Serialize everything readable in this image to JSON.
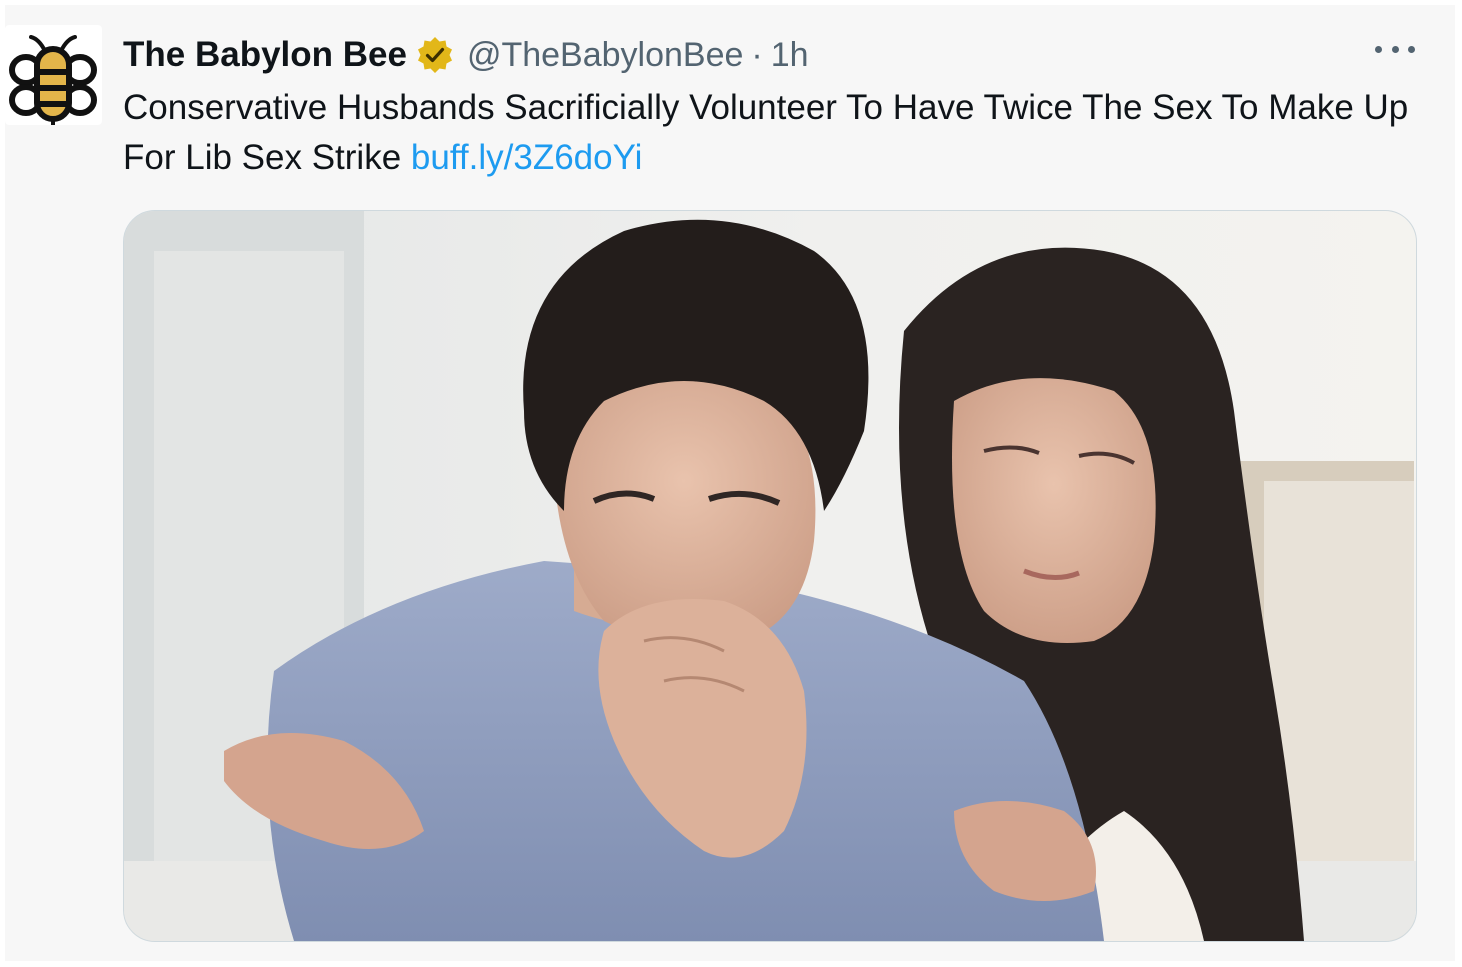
{
  "tweet": {
    "author_name": "The Babylon Bee",
    "handle": "@TheBabylonBee",
    "separator": "·",
    "time": "1h",
    "text": "Conservative Husbands Sacrificially Volunteer To Have Twice The Sex To Make Up For Lib Sex Strike",
    "link": "buff.ly/3Z6doYi",
    "verified_icon": "gold-verified-badge-icon",
    "more_icon": "more-options-icon",
    "media_alt": "man-and-woman-photo"
  },
  "colors": {
    "text": "#0f1419",
    "secondary": "#536471",
    "link": "#1d9bf0",
    "verified_gold": "#e2b719",
    "background": "#f7f7f7"
  }
}
